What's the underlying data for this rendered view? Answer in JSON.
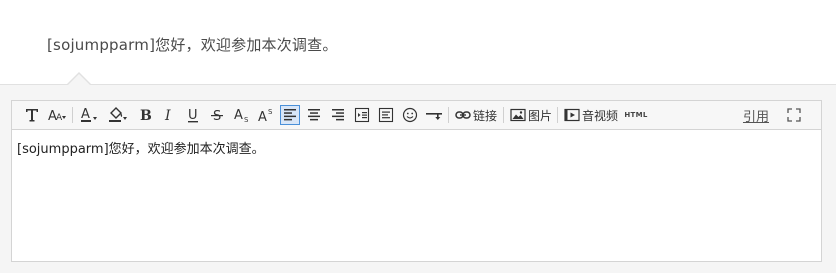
{
  "preview": {
    "text": "[sojumpparm]您好，欢迎参加本次调查。"
  },
  "toolbar": {
    "link_label": "链接",
    "image_label": "图片",
    "video_label": "音视频",
    "html_label": "HTML",
    "quote_label": "引用"
  },
  "editor": {
    "content": "[sojumpparm]您好，欢迎参加本次调查。"
  }
}
